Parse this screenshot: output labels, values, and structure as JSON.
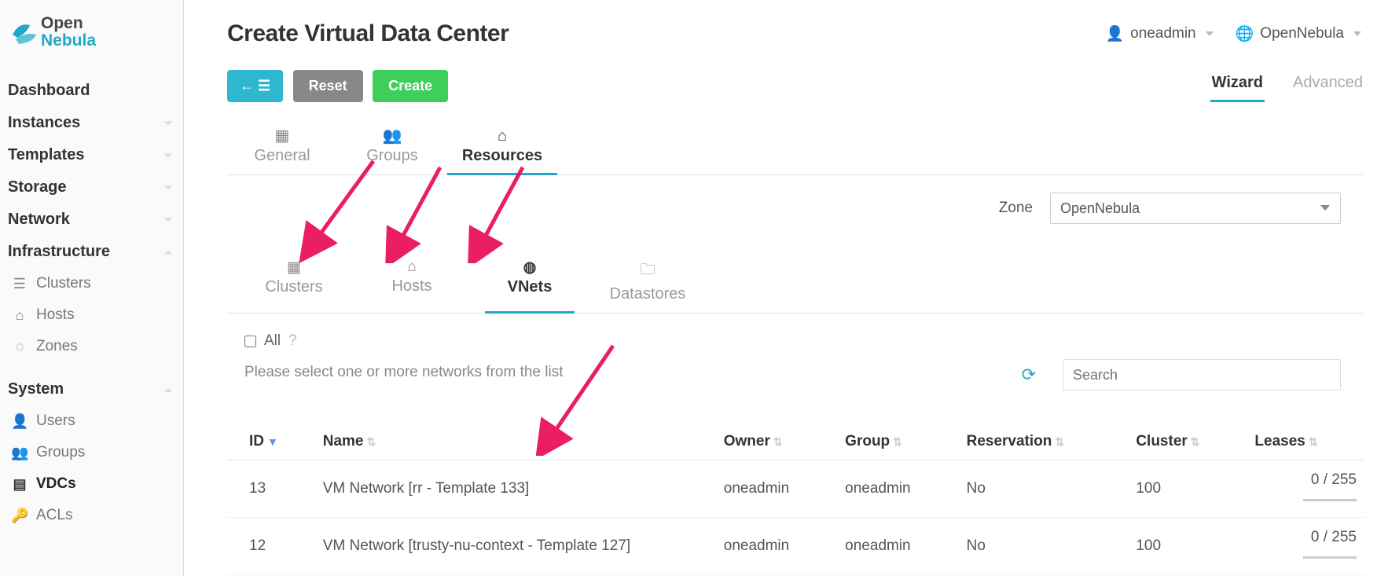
{
  "brand": {
    "line1": "Open",
    "line2": "Nebula"
  },
  "sidebar": {
    "dashboard": "Dashboard",
    "instances": "Instances",
    "templates": "Templates",
    "storage": "Storage",
    "network": "Network",
    "infrastructure": "Infrastructure",
    "infra_items": {
      "clusters": "Clusters",
      "hosts": "Hosts",
      "zones": "Zones"
    },
    "system": "System",
    "system_items": {
      "users": "Users",
      "groups": "Groups",
      "vdcs": "VDCs",
      "acls": "ACLs"
    }
  },
  "header": {
    "title": "Create Virtual Data Center",
    "user": "oneadmin",
    "zone": "OpenNebula"
  },
  "actions": {
    "reset": "Reset",
    "create": "Create"
  },
  "mode_tabs": {
    "wizard": "Wizard",
    "advanced": "Advanced"
  },
  "wizard_tabs": {
    "general": "General",
    "groups": "Groups",
    "resources": "Resources"
  },
  "zone_label": "Zone",
  "zone_value": "OpenNebula",
  "sub_tabs": {
    "clusters": "Clusters",
    "hosts": "Hosts",
    "vnets": "VNets",
    "datastores": "Datastores"
  },
  "all_label": "All",
  "hint": "Please select one or more networks from the list",
  "search_placeholder": "Search",
  "table": {
    "headers": {
      "id": "ID",
      "name": "Name",
      "owner": "Owner",
      "group": "Group",
      "reservation": "Reservation",
      "cluster": "Cluster",
      "leases": "Leases"
    },
    "rows": [
      {
        "id": "13",
        "name": "VM Network [rr - Template 133]",
        "owner": "oneadmin",
        "group": "oneadmin",
        "reservation": "No",
        "cluster": "100",
        "leases": "0 / 255"
      },
      {
        "id": "12",
        "name": "VM Network [trusty-nu-context - Template 127]",
        "owner": "oneadmin",
        "group": "oneadmin",
        "reservation": "No",
        "cluster": "100",
        "leases": "0 / 255"
      }
    ]
  }
}
